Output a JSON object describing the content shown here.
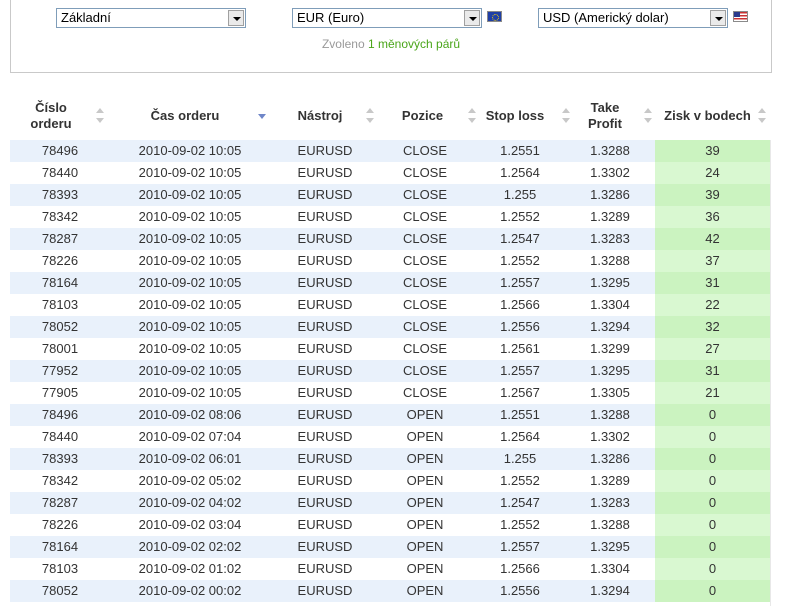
{
  "filters": {
    "type_select": "Základní",
    "base_select": "EUR (Euro)",
    "quote_select": "USD (Americký dolar)",
    "chosen_prefix": "Zvoleno",
    "chosen_highlight": "1 měnových párů",
    "base_flag": "eu-flag-icon",
    "quote_flag": "us-flag-icon"
  },
  "table": {
    "headers": {
      "order_no": "Číslo orderu",
      "order_time": "Čas orderu",
      "instrument": "Nástroj",
      "position": "Pozice",
      "stop_loss": "Stop loss",
      "take_profit": "Take Profit",
      "profit_points": "Zisk v bodech"
    },
    "sorted_column": "order_time",
    "sort_direction": "descending",
    "rows": [
      {
        "id": "78496",
        "time": "2010-09-02 10:05",
        "instrument": "EURUSD",
        "position": "CLOSE",
        "sl": "1.2551",
        "tp": "1.3288",
        "profit": "39"
      },
      {
        "id": "78440",
        "time": "2010-09-02 10:05",
        "instrument": "EURUSD",
        "position": "CLOSE",
        "sl": "1.2564",
        "tp": "1.3302",
        "profit": "24"
      },
      {
        "id": "78393",
        "time": "2010-09-02 10:05",
        "instrument": "EURUSD",
        "position": "CLOSE",
        "sl": "1.255",
        "tp": "1.3286",
        "profit": "39"
      },
      {
        "id": "78342",
        "time": "2010-09-02 10:05",
        "instrument": "EURUSD",
        "position": "CLOSE",
        "sl": "1.2552",
        "tp": "1.3289",
        "profit": "36"
      },
      {
        "id": "78287",
        "time": "2010-09-02 10:05",
        "instrument": "EURUSD",
        "position": "CLOSE",
        "sl": "1.2547",
        "tp": "1.3283",
        "profit": "42"
      },
      {
        "id": "78226",
        "time": "2010-09-02 10:05",
        "instrument": "EURUSD",
        "position": "CLOSE",
        "sl": "1.2552",
        "tp": "1.3288",
        "profit": "37"
      },
      {
        "id": "78164",
        "time": "2010-09-02 10:05",
        "instrument": "EURUSD",
        "position": "CLOSE",
        "sl": "1.2557",
        "tp": "1.3295",
        "profit": "31"
      },
      {
        "id": "78103",
        "time": "2010-09-02 10:05",
        "instrument": "EURUSD",
        "position": "CLOSE",
        "sl": "1.2566",
        "tp": "1.3304",
        "profit": "22"
      },
      {
        "id": "78052",
        "time": "2010-09-02 10:05",
        "instrument": "EURUSD",
        "position": "CLOSE",
        "sl": "1.2556",
        "tp": "1.3294",
        "profit": "32"
      },
      {
        "id": "78001",
        "time": "2010-09-02 10:05",
        "instrument": "EURUSD",
        "position": "CLOSE",
        "sl": "1.2561",
        "tp": "1.3299",
        "profit": "27"
      },
      {
        "id": "77952",
        "time": "2010-09-02 10:05",
        "instrument": "EURUSD",
        "position": "CLOSE",
        "sl": "1.2557",
        "tp": "1.3295",
        "profit": "31"
      },
      {
        "id": "77905",
        "time": "2010-09-02 10:05",
        "instrument": "EURUSD",
        "position": "CLOSE",
        "sl": "1.2567",
        "tp": "1.3305",
        "profit": "21"
      },
      {
        "id": "78496",
        "time": "2010-09-02 08:06",
        "instrument": "EURUSD",
        "position": "OPEN",
        "sl": "1.2551",
        "tp": "1.3288",
        "profit": "0"
      },
      {
        "id": "78440",
        "time": "2010-09-02 07:04",
        "instrument": "EURUSD",
        "position": "OPEN",
        "sl": "1.2564",
        "tp": "1.3302",
        "profit": "0"
      },
      {
        "id": "78393",
        "time": "2010-09-02 06:01",
        "instrument": "EURUSD",
        "position": "OPEN",
        "sl": "1.255",
        "tp": "1.3286",
        "profit": "0"
      },
      {
        "id": "78342",
        "time": "2010-09-02 05:02",
        "instrument": "EURUSD",
        "position": "OPEN",
        "sl": "1.2552",
        "tp": "1.3289",
        "profit": "0"
      },
      {
        "id": "78287",
        "time": "2010-09-02 04:02",
        "instrument": "EURUSD",
        "position": "OPEN",
        "sl": "1.2547",
        "tp": "1.3283",
        "profit": "0"
      },
      {
        "id": "78226",
        "time": "2010-09-02 03:04",
        "instrument": "EURUSD",
        "position": "OPEN",
        "sl": "1.2552",
        "tp": "1.3288",
        "profit": "0"
      },
      {
        "id": "78164",
        "time": "2010-09-02 02:02",
        "instrument": "EURUSD",
        "position": "OPEN",
        "sl": "1.2557",
        "tp": "1.3295",
        "profit": "0"
      },
      {
        "id": "78103",
        "time": "2010-09-02 01:02",
        "instrument": "EURUSD",
        "position": "OPEN",
        "sl": "1.2566",
        "tp": "1.3304",
        "profit": "0"
      },
      {
        "id": "78052",
        "time": "2010-09-02 00:02",
        "instrument": "EURUSD",
        "position": "OPEN",
        "sl": "1.2556",
        "tp": "1.3294",
        "profit": "0"
      }
    ]
  },
  "colors": {
    "row_alt": "#e9f1fb",
    "profit_bg": "#d9f8d1",
    "highlight_text": "#4aa51a"
  }
}
